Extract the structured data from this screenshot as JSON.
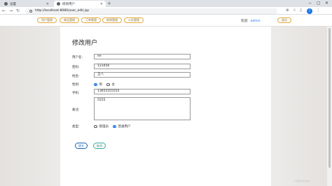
{
  "browser": {
    "tabs": [
      {
        "label": "设置",
        "active": false
      },
      {
        "label": "修改用户",
        "active": true
      }
    ],
    "url": "http://localhost:8080/user_edit.jsp",
    "window_controls": [
      "−",
      "▢",
      "✕"
    ]
  },
  "nav": {
    "items": [
      "用户管理",
      "商品管理",
      "订单管理",
      "新闻管理",
      "公告管理"
    ],
    "welcome_label": "欢迎:",
    "username": "admin",
    "exit_label": "退出"
  },
  "page": {
    "title": "修改用户"
  },
  "form": {
    "username_label": "用户名:",
    "username_value": "ee",
    "password_label": "密码:",
    "password_value": "123456",
    "name_label": "姓名:",
    "name_value": "王八",
    "gender_label": "性别:",
    "gender_options": [
      "男",
      "女"
    ],
    "gender_selected": "男",
    "phone_label": "手机:",
    "phone_value": "13655555555",
    "remark_label": "备注:",
    "remark_value": "5555",
    "type_label": "类型:",
    "type_options": [
      "管理员",
      "普通用户"
    ],
    "type_selected": "普通用户",
    "submit_label": "提交",
    "back_label": "取消"
  },
  "footer": {
    "text": "CSDN @xxxx"
  },
  "colors": {
    "accent": "#1a73e8",
    "nav_border": "#e2a93b"
  }
}
